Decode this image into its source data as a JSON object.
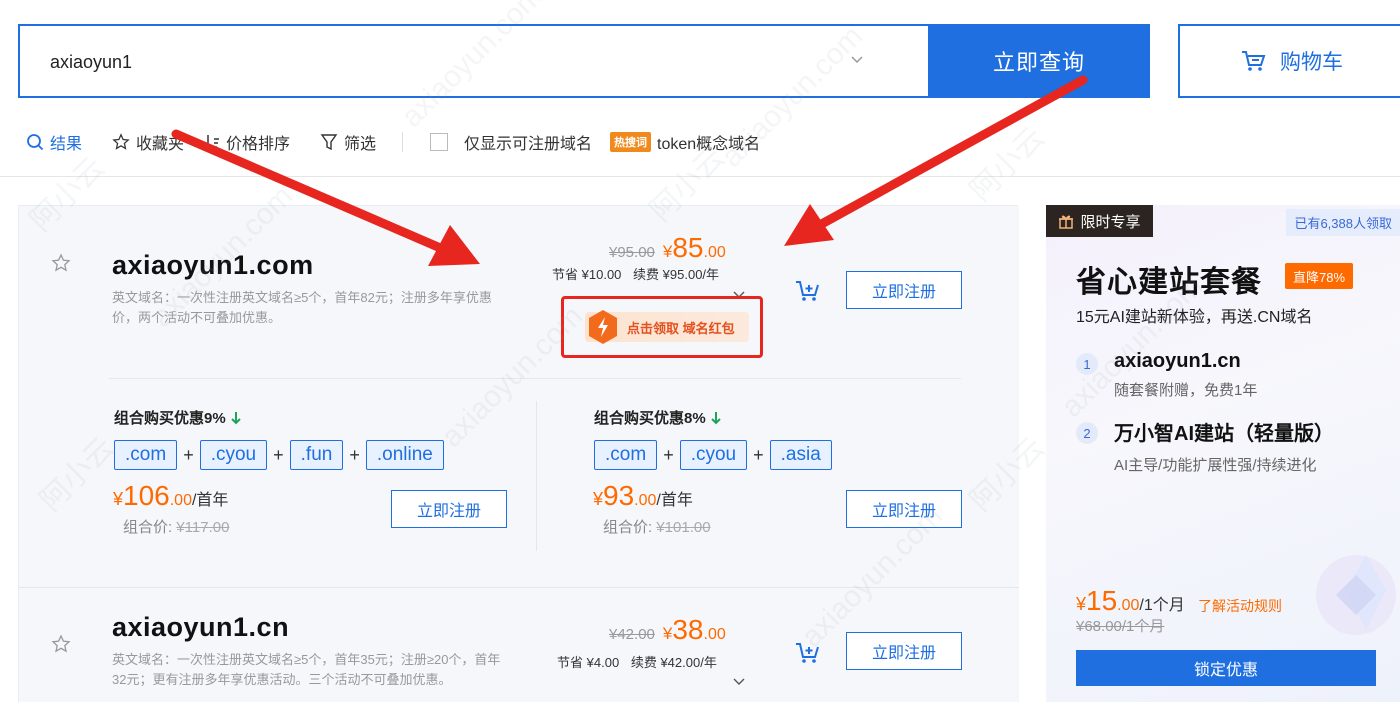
{
  "search": {
    "value": "axiaoyun1",
    "button_label": "立即查询",
    "cart_label": "购物车"
  },
  "toolbar": {
    "results_label": "结果",
    "favorites_label": "收藏夹",
    "sort_label": "价格排序",
    "filter_label": "筛选",
    "available_only_label": "仅显示可注册域名",
    "hot_badge": "热搜词",
    "hot_keyword": "token概念域名"
  },
  "domains": [
    {
      "name": "axiaoyun1.com",
      "desc_line1": "英文域名：一次性注册英文域名≥5个，首年82元；注册多年享优惠",
      "desc_line2": "价，两个活动不可叠加优惠。",
      "old_price": "¥95.00",
      "price_symbol": "¥",
      "price_int": "85",
      "price_dec": ".00",
      "save_label": "节省",
      "save_value": "¥10.00",
      "renew_label": "续费",
      "renew_value": "¥95.00/年",
      "register_label": "立即注册",
      "coupon_label": "点击领取 域名红包"
    },
    {
      "name": "axiaoyun1.cn",
      "desc_line1": "英文域名：一次性注册英文域名≥5个，首年35元；注册≥20个，首年",
      "desc_line2": "32元；更有注册多年享优惠活动。三个活动不可叠加优惠。",
      "old_price": "¥42.00",
      "price_symbol": "¥",
      "price_int": "38",
      "price_dec": ".00",
      "save_label": "节省",
      "save_value": "¥4.00",
      "renew_label": "续费",
      "renew_value": "¥42.00/年",
      "register_label": "立即注册"
    }
  ],
  "combos": [
    {
      "title": "组合购买优惠9%",
      "tags": [
        ".com",
        ".cyou",
        ".fun",
        ".online"
      ],
      "price_symbol": "¥",
      "price_int": "106",
      "price_dec": ".00",
      "unit": "/首年",
      "orig_label": "组合价: ",
      "orig_value": "¥117.00",
      "register_label": "立即注册"
    },
    {
      "title": "组合购买优惠8%",
      "tags": [
        ".com",
        ".cyou",
        ".asia"
      ],
      "price_symbol": "¥",
      "price_int": "93",
      "price_dec": ".00",
      "unit": "/首年",
      "orig_label": "组合价: ",
      "orig_value": "¥101.00",
      "register_label": "立即注册"
    }
  ],
  "plus_sign": "+",
  "ad": {
    "tag": "限时专享",
    "count": "已有6,388人领取",
    "title": "省心建站套餐",
    "badge": "直降78%",
    "subtitle": "15元AI建站新体验，再送.CN域名",
    "items": [
      {
        "num": "1",
        "title": "axiaoyun1.cn",
        "desc": "随套餐附赠，免费1年"
      },
      {
        "num": "2",
        "title": "万小智AI建站（轻量版）",
        "desc": "AI主导/功能扩展性强/持续进化"
      }
    ],
    "price_symbol": "¥",
    "price_int": "15",
    "price_dec": ".00",
    "price_unit": "/1个月",
    "rule_link": "了解活动规则",
    "orig_price": "¥68.00/1个月",
    "button_label": "锁定优惠"
  },
  "watermark": "axiaoyun.com",
  "watermark_cn": "阿小云",
  "colors": {
    "brand_blue": "#1f6fe0",
    "price_orange": "#ff6a00",
    "annotation_red": "#e6261f"
  }
}
